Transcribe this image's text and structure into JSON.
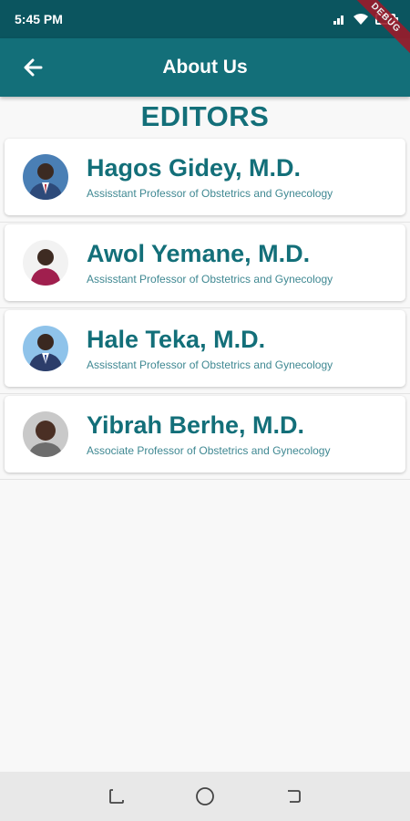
{
  "status_bar": {
    "time": "5:45 PM",
    "icons": [
      "signal-icon",
      "wifi-icon",
      "battery-icon"
    ]
  },
  "debug_banner": "DEBUG",
  "app_bar": {
    "title": "About Us",
    "back_icon": "back-arrow-icon"
  },
  "section": {
    "title": "EDITORS"
  },
  "editors": [
    {
      "name": "Hagos Gidey, M.D.",
      "title": "Assisstant Professor of Obstetrics and Gynecology",
      "avatar": "photo-avatar"
    },
    {
      "name": "Awol Yemane, M.D.",
      "title": "Assisstant Professor of Obstetrics and Gynecology",
      "avatar": "photo-avatar"
    },
    {
      "name": "Hale Teka, M.D.",
      "title": "Assisstant Professor of Obstetrics and Gynecology",
      "avatar": "photo-avatar"
    },
    {
      "name": "Yibrah Berhe, M.D.",
      "title": "Associate Professor of Obstetrics and Gynecology",
      "avatar": "photo-avatar"
    }
  ],
  "nav_bar": {
    "buttons": [
      "recents-icon",
      "home-icon",
      "back-icon"
    ]
  },
  "colors": {
    "status_bar": "#0b555f",
    "app_bar": "#136f79",
    "accent_text": "#136f79",
    "background": "#f8f8f8"
  }
}
